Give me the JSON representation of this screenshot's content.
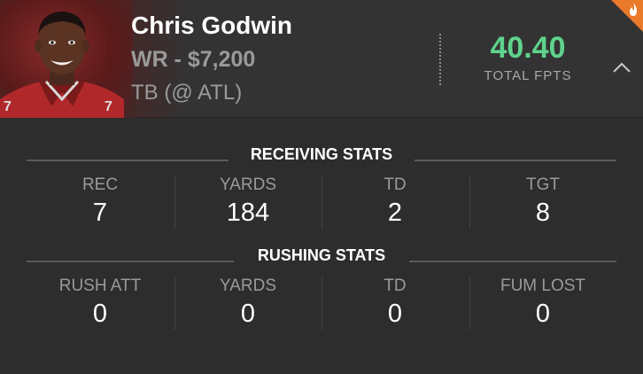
{
  "player": {
    "name": "Chris Godwin",
    "position_salary": "WR - $7,200",
    "matchup": "TB (@ ATL)",
    "fpts": "40.40",
    "fpts_label": "TOTAL FPTS"
  },
  "receiving": {
    "title": "RECEIVING STATS",
    "stats": [
      {
        "label": "REC",
        "value": "7"
      },
      {
        "label": "YARDS",
        "value": "184"
      },
      {
        "label": "TD",
        "value": "2"
      },
      {
        "label": "TGT",
        "value": "8"
      }
    ]
  },
  "rushing": {
    "title": "RUSHING STATS",
    "stats": [
      {
        "label": "RUSH ATT",
        "value": "0"
      },
      {
        "label": "YARDS",
        "value": "0"
      },
      {
        "label": "TD",
        "value": "0"
      },
      {
        "label": "FUM LOST",
        "value": "0"
      }
    ]
  },
  "colors": {
    "fpts_green": "#5fd38c",
    "flame_orange": "#e87a2a",
    "background": "#2d2d2d"
  },
  "icons": {
    "collapse": "chevron-up-icon",
    "hot": "flame-icon"
  }
}
